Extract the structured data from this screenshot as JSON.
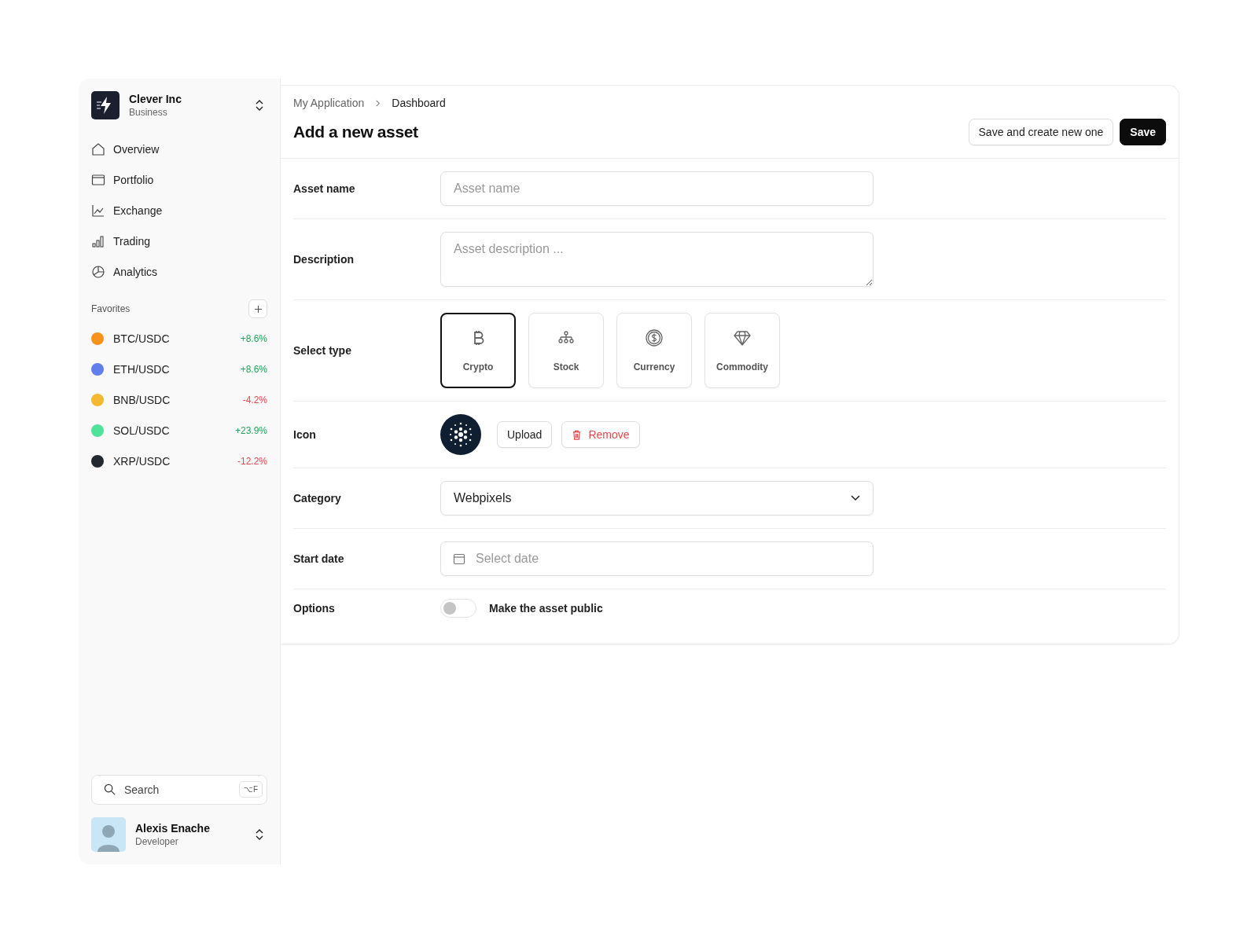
{
  "workspace": {
    "name": "Clever Inc",
    "plan": "Business"
  },
  "nav": [
    {
      "label": "Overview",
      "selected": false
    },
    {
      "label": "Portfolio",
      "selected": false
    },
    {
      "label": "Exchange",
      "selected": false
    },
    {
      "label": "Trading",
      "selected": false
    },
    {
      "label": "Analytics",
      "selected": false
    }
  ],
  "favorites": {
    "title": "Favorites",
    "items": [
      {
        "pair": "BTC/USDC",
        "change": {
          "text": "+8.6%",
          "color": "#22a55b"
        },
        "color": "#f7931a"
      },
      {
        "pair": "ETH/USDC",
        "change": {
          "text": "+8.6%",
          "color": "#22a55b"
        },
        "color": "#627eea"
      },
      {
        "pair": "BNB/USDC",
        "change": {
          "text": "-4.2%",
          "color": "#e5484d"
        },
        "color": "#f3ba2f"
      },
      {
        "pair": "SOL/USDC",
        "change": {
          "text": "+23.9%",
          "color": "#22a55b"
        },
        "color": "#4ee39a"
      },
      {
        "pair": "XRP/USDC",
        "change": {
          "text": "-12.2%",
          "color": "#e5484d"
        },
        "color": "#23292f"
      }
    ]
  },
  "search": {
    "placeholder": "Search",
    "shortcut": "⌥F"
  },
  "user": {
    "name": "Alexis Enache",
    "role": "Developer"
  },
  "breadcrumb": [
    "My Application",
    "Dashboard"
  ],
  "title": "Add a new asset",
  "actions": [
    {
      "label": "Save and create new one",
      "kind": "secondary"
    },
    {
      "label": "Save",
      "kind": "primary"
    }
  ],
  "form": [
    {
      "label": "Asset name",
      "kind": "text",
      "placeholder": "Asset name"
    },
    {
      "label": "Description",
      "kind": "textarea",
      "placeholder": "Asset description ..."
    },
    {
      "label": "Select type",
      "kind": "types",
      "options": [
        {
          "label": "Crypto",
          "selected": true
        },
        {
          "label": "Stock",
          "selected": false
        },
        {
          "label": "Currency",
          "selected": false
        },
        {
          "label": "Commodity",
          "selected": false
        }
      ]
    },
    {
      "label": "Icon",
      "kind": "icon",
      "buttons": [
        "Upload",
        "Remove"
      ]
    },
    {
      "label": "Category",
      "kind": "select",
      "value": "Webpixels"
    },
    {
      "label": "Start date",
      "kind": "date",
      "placeholder": "Select date"
    },
    {
      "label": "Options",
      "kind": "toggle",
      "on": false,
      "text": "Make the asset public"
    }
  ]
}
